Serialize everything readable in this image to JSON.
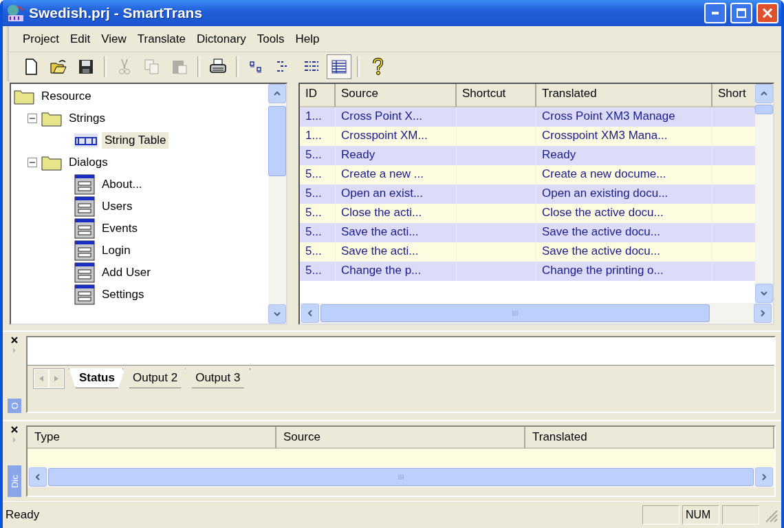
{
  "window": {
    "title": "Swedish.prj - SmartTrans"
  },
  "menu": [
    "Project",
    "Edit",
    "View",
    "Translate",
    "Dictonary",
    "Tools",
    "Help"
  ],
  "toolbar": [
    {
      "kind": "new",
      "disabled": false,
      "pressed": false
    },
    {
      "kind": "open",
      "disabled": false,
      "pressed": false
    },
    {
      "kind": "save",
      "disabled": false,
      "pressed": false
    },
    {
      "kind": "sep"
    },
    {
      "kind": "cut",
      "disabled": true,
      "pressed": false
    },
    {
      "kind": "copy",
      "disabled": true,
      "pressed": false
    },
    {
      "kind": "paste",
      "disabled": true,
      "pressed": false
    },
    {
      "kind": "sep"
    },
    {
      "kind": "print",
      "disabled": false,
      "pressed": false
    },
    {
      "kind": "sep"
    },
    {
      "kind": "view1",
      "disabled": false,
      "pressed": false
    },
    {
      "kind": "view2",
      "disabled": false,
      "pressed": false
    },
    {
      "kind": "view3",
      "disabled": false,
      "pressed": false
    },
    {
      "kind": "view4",
      "disabled": false,
      "pressed": true
    },
    {
      "kind": "sep"
    },
    {
      "kind": "help",
      "disabled": false,
      "pressed": false
    }
  ],
  "tree": [
    {
      "label": "Resource",
      "kind": "folder",
      "selected": false,
      "children": [
        {
          "label": "Strings",
          "kind": "folder",
          "expanded": true,
          "selected": false,
          "children": [
            {
              "label": "String Table",
              "kind": "string",
              "selected": true
            }
          ]
        },
        {
          "label": "Dialogs",
          "kind": "folder",
          "expanded": true,
          "selected": false,
          "children": [
            {
              "label": "About...",
              "kind": "dialog",
              "selected": false
            },
            {
              "label": "Users",
              "kind": "dialog",
              "selected": false
            },
            {
              "label": "Events",
              "kind": "dialog",
              "selected": false
            },
            {
              "label": "Login",
              "kind": "dialog",
              "selected": false
            },
            {
              "label": "Add User",
              "kind": "dialog",
              "selected": false
            },
            {
              "label": "Settings",
              "kind": "dialog",
              "selected": false
            }
          ]
        }
      ]
    }
  ],
  "table": {
    "columns": [
      "ID",
      "Source",
      "Shortcut",
      "Translated",
      "Short"
    ],
    "rows": [
      {
        "id": "1...",
        "source": "Cross Point X...",
        "translated": "Cross Point XM3 Manage"
      },
      {
        "id": "1...",
        "source": "Crosspoint XM...",
        "translated": "Crosspoint XM3 Mana..."
      },
      {
        "id": "5...",
        "source": "Ready",
        "translated": "Ready"
      },
      {
        "id": "5...",
        "source": "Create a new ...",
        "translated": "Create a new docume..."
      },
      {
        "id": "5...",
        "source": "Open an exist...",
        "translated": "Open an existing docu..."
      },
      {
        "id": "5...",
        "source": "Close the acti...",
        "translated": "Close the active docu..."
      },
      {
        "id": "5...",
        "source": "Save the acti...",
        "translated": "Save the active docu..."
      },
      {
        "id": "5...",
        "source": "Save the acti...",
        "translated": "Save the active docu..."
      },
      {
        "id": "5...",
        "source": "Change the p...",
        "translated": "Change the printing o..."
      }
    ]
  },
  "output_pane": {
    "side_label": "O",
    "tabs": [
      {
        "label": "Status",
        "selected": true
      },
      {
        "label": "Output 2",
        "selected": false
      },
      {
        "label": "Output 3",
        "selected": false
      }
    ]
  },
  "dictionary_pane": {
    "side_label": "Dic",
    "columns": [
      "Type",
      "Source",
      "Translated"
    ]
  },
  "status_bar": {
    "text": "Ready",
    "indicators": [
      "NUM"
    ]
  }
}
